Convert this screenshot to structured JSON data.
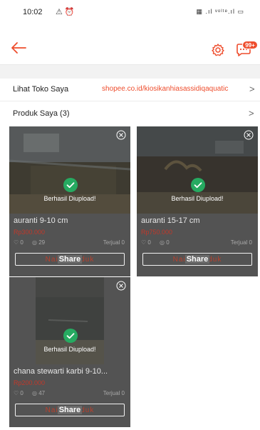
{
  "status_bar": {
    "time": "10:02",
    "left_icons": "⚠ ⏰",
    "right_icons": "▦ .ıl ᵛᵒˡᵗᵉ.ıl ▭"
  },
  "header": {
    "chat_badge": "99+"
  },
  "shop": {
    "label": "Lihat Toko Saya",
    "link": "shopee.co.id/kiosikanhiasassidiqaquatic",
    "chevron": ">"
  },
  "products": {
    "title": "Produk Saya (3)",
    "chevron": ">",
    "items": [
      {
        "success": "Berhasil Diupload!",
        "name": "auranti 9-10 cm",
        "price": "Rp300.000",
        "likes": "0",
        "views": "29",
        "sold": "Terjual 0",
        "button_bg": "Naiki Produk",
        "share": "Share"
      },
      {
        "success": "Berhasil Diupload!",
        "name": "auranti 15-17 cm",
        "price": "Rp750.000",
        "likes": "0",
        "views": "0",
        "sold": "Terjual 0",
        "button_bg": "Naiki Produk",
        "share": "Share"
      },
      {
        "success": "Berhasil Diupload!",
        "name": "chana stewarti karbi 9-10...",
        "price": "Rp200.000",
        "likes": "0",
        "views": "47",
        "sold": "Terjual 0",
        "button_bg": "Naiki Produk",
        "share": "Share"
      }
    ]
  },
  "colors": {
    "accent": "#ee4d2d",
    "success": "#26aa61",
    "price": "#c0392b"
  }
}
